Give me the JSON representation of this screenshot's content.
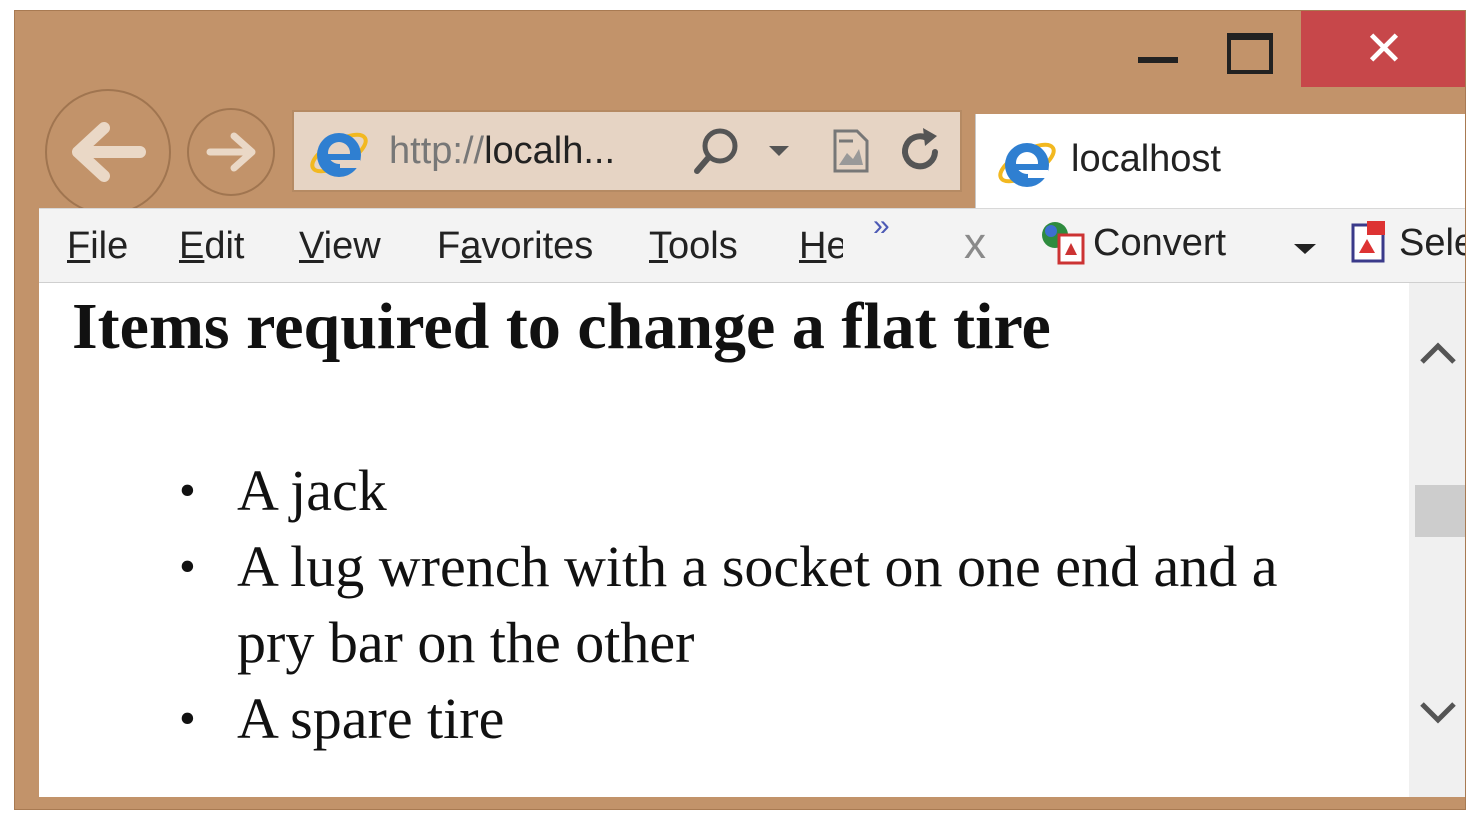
{
  "window": {
    "url": "http://localh...",
    "url_prefix": "http://",
    "url_host": "localh...",
    "tab_title": "localhost",
    "close_glyph": "✕"
  },
  "menu": {
    "items": [
      {
        "accel": "F",
        "rest": "ile"
      },
      {
        "accel": "E",
        "rest": "dit"
      },
      {
        "accel": "V",
        "rest": "iew"
      },
      {
        "pre": "F",
        "accel": "a",
        "rest": "vorites"
      },
      {
        "accel": "T",
        "rest": "ools"
      },
      {
        "accel": "H",
        "rest": "e"
      }
    ],
    "overflow": "»",
    "close": "x",
    "convert_label": "Convert",
    "select_label": "Sele"
  },
  "page": {
    "title": "Items required to change a flat tire",
    "items": [
      "A jack",
      "A lug wrench with a socket on one end and a pry bar on the other",
      "A spare tire"
    ]
  },
  "colors": {
    "frame": "#c2936a",
    "close": "#c7474a",
    "address_bg": "#e6d4c4",
    "ie_blue": "#2f7fd1"
  },
  "icons": {
    "back": "back-arrow-icon",
    "forward": "forward-arrow-icon",
    "search": "search-icon",
    "dropdown": "dropdown-arrow-icon",
    "compat": "compatibility-view-icon",
    "refresh": "refresh-icon"
  }
}
